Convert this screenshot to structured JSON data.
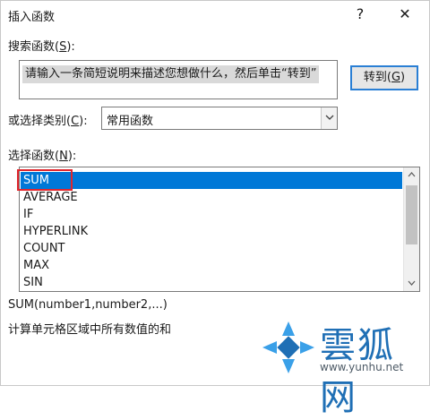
{
  "dialog": {
    "title": "插入函数",
    "help_label": "?",
    "close_label": "✕"
  },
  "search": {
    "label": "搜索函数",
    "label_hotkey": "S",
    "value": "请输入一条简短说明来描述您想做什么，然后单击“转到”",
    "goto_label": "转到",
    "goto_hotkey": "G"
  },
  "category": {
    "label": "或选择类别",
    "label_hotkey": "C",
    "selected": "常用函数"
  },
  "functions": {
    "label": "选择函数",
    "label_hotkey": "N",
    "items": [
      "SUM",
      "AVERAGE",
      "IF",
      "HYPERLINK",
      "COUNT",
      "MAX",
      "SIN"
    ],
    "selected": "SUM"
  },
  "details": {
    "signature": "SUM(number1,number2,...)",
    "description": "计算单元格区域中所有数值的和"
  },
  "watermark": {
    "name": "雲狐网",
    "url": "www.yunhu.net"
  },
  "colors": {
    "selection": "#0078d7",
    "highlight_box": "#e0262d",
    "focus_border": "#2a7fd4",
    "watermark_blue": "#1f6fb5"
  }
}
